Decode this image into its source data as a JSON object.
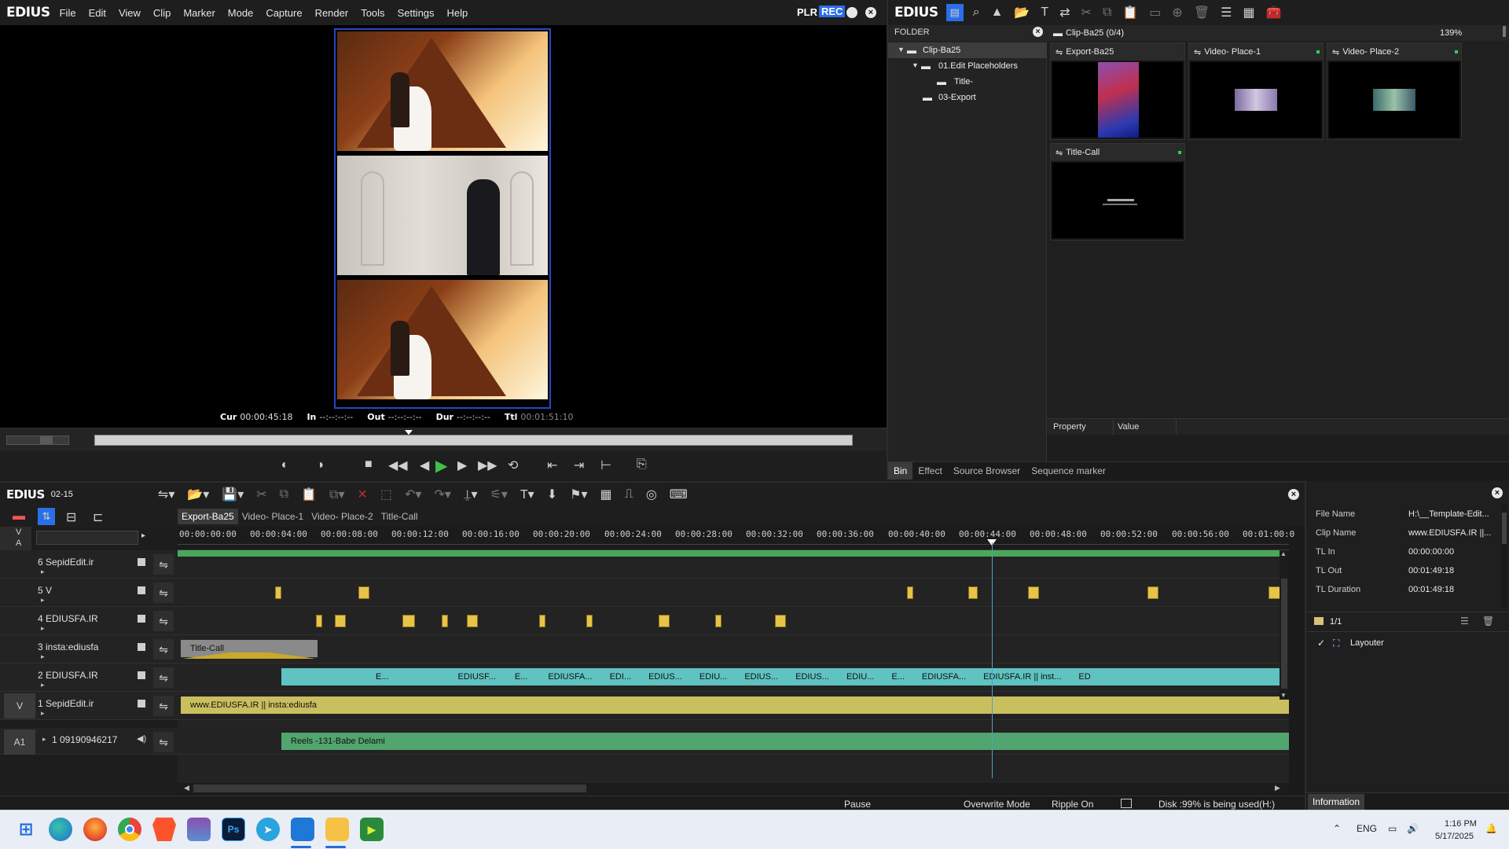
{
  "player": {
    "app_name": "EDIUS",
    "menu": [
      "File",
      "Edit",
      "View",
      "Clip",
      "Marker",
      "Mode",
      "Capture",
      "Render",
      "Tools",
      "Settings",
      "Help"
    ],
    "mode_plr": "PLR",
    "mode_rec": "REC",
    "timecode": {
      "cur_label": "Cur",
      "cur": "00:00:45:18",
      "in_label": "In",
      "in": "--:--:--:--",
      "out_label": "Out",
      "out": "--:--:--:--",
      "dur_label": "Dur",
      "dur": "--:--:--:--",
      "ttl_label": "Ttl",
      "ttl": "00:01:51:10"
    }
  },
  "bin": {
    "app_name": "EDIUS",
    "folder_header": "FOLDER",
    "current_folder": "Clip-Ba25 (0/4)",
    "zoom": "139%",
    "tree": [
      {
        "label": "Clip-Ba25",
        "level": 0
      },
      {
        "label": "01.Edit Placeholders",
        "level": 1
      },
      {
        "label": "Title-",
        "level": 2
      },
      {
        "label": "03-Export",
        "level": 1
      }
    ],
    "clips": [
      {
        "name": "Export-Ba25"
      },
      {
        "name": "Video- Place-1"
      },
      {
        "name": "Video- Place-2"
      },
      {
        "name": "Title-Call"
      }
    ],
    "property_header": "Property",
    "value_header": "Value",
    "tabs": [
      "Bin",
      "Effect",
      "Source Browser",
      "Sequence marker"
    ]
  },
  "timeline": {
    "app_name": "EDIUS",
    "project": "02-15",
    "sequence_tabs": [
      "Export-Ba25",
      "Video- Place-1",
      "Video- Place-2",
      "Title-Call"
    ],
    "ruler_labels": [
      "00:00:00:00",
      "00:00:04:00",
      "00:00:08:00",
      "00:00:12:00",
      "00:00:16:00",
      "00:00:20:00",
      "00:00:24:00",
      "00:00:28:00",
      "00:00:32:00",
      "00:00:36:00",
      "00:00:40:00",
      "00:00:44:00",
      "00:00:48:00",
      "00:00:52:00",
      "00:00:56:00",
      "00:01:00:0"
    ],
    "va_v": "V",
    "va_a": "A",
    "tracks": [
      {
        "name": "6 SepidEdit.ir"
      },
      {
        "name": "5 V"
      },
      {
        "name": "4 EDIUSFA.IR"
      },
      {
        "name": "3 insta:ediusfa"
      },
      {
        "name": "2 EDIUSFA.IR"
      },
      {
        "name": "1 SepidEdit.ir"
      },
      {
        "name": "1 09190946217"
      }
    ],
    "patch_v": "V",
    "patch_a1": "A1",
    "clips": {
      "title_call": "Title-Call",
      "track2_a": "E...",
      "track2_b": "EDIUSF...",
      "track2_c": "E...",
      "track2_d": "EDIUSFA...",
      "track2_e": "EDI...",
      "track2_f": "EDIUS...",
      "track2_g": "EDIU...",
      "track2_h": "EDIUS...",
      "track2_i": "EDIUS...",
      "track2_j": "EDIU...",
      "track2_k": "E...",
      "track2_l": "EDIUSFA...",
      "track2_m": "EDIUSFA.IR || inst...",
      "track2_n": "ED",
      "track1": "www.EDIUSFA.IR || insta:ediusfa",
      "audio": "Reels -131-Babe Delami"
    },
    "status": {
      "pause": "Pause",
      "overwrite": "Overwrite Mode",
      "ripple": "Ripple On",
      "disk": "Disk :99% is being used(H:)"
    }
  },
  "info": {
    "rows": [
      {
        "k": "File Name",
        "v": "H:\\__Template-Edit..."
      },
      {
        "k": "Clip Name",
        "v": "www.EDIUSFA.IR ||..."
      },
      {
        "k": "TL In",
        "v": "00:00:00:00"
      },
      {
        "k": "TL Out",
        "v": "00:01:49:18"
      },
      {
        "k": "TL Duration",
        "v": "00:01:49:18"
      }
    ],
    "page": "1/1",
    "effect_item": "Layouter",
    "tab": "Information"
  },
  "taskbar": {
    "lang": "ENG",
    "time": "1:16 PM",
    "date": "5/17/2025",
    "apps": [
      {
        "name": "start"
      },
      {
        "name": "edge"
      },
      {
        "name": "firefox"
      },
      {
        "name": "chrome"
      },
      {
        "name": "brave"
      },
      {
        "name": "winrar"
      },
      {
        "name": "photoshop"
      },
      {
        "name": "telegram"
      },
      {
        "name": "edius"
      },
      {
        "name": "file-explorer"
      },
      {
        "name": "media-player"
      }
    ]
  }
}
